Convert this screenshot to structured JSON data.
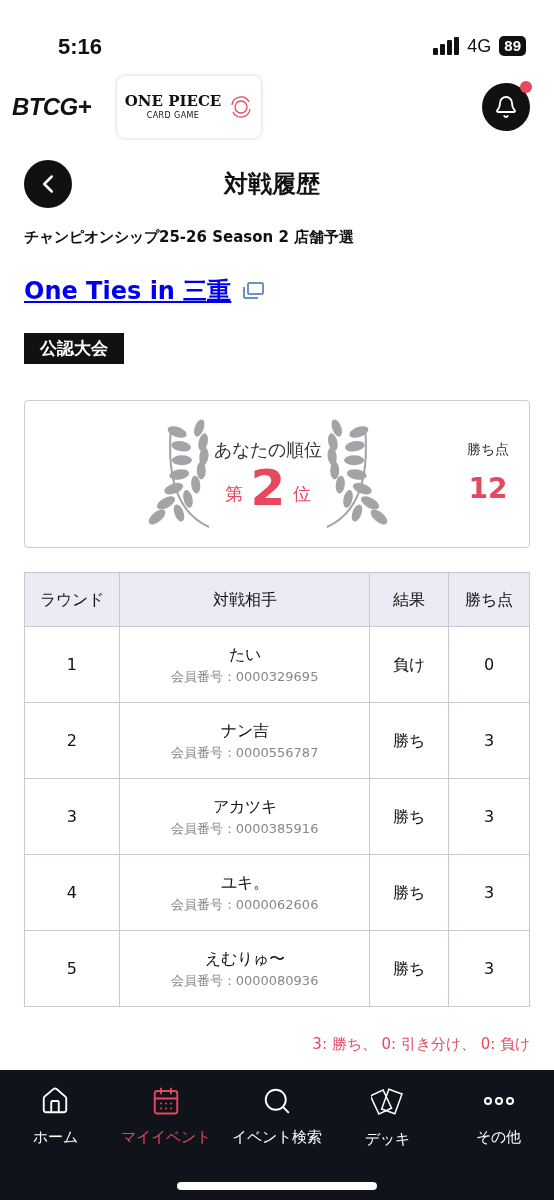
{
  "status_bar": {
    "time": "5:16",
    "network": "4G",
    "battery": "89"
  },
  "header": {
    "logo_text": "BTCG+",
    "game_logo": {
      "title": "ONE PIECE",
      "subtitle": "CARD GAME"
    },
    "notification_unread": true
  },
  "page": {
    "title": "対戦履歴",
    "event_series": "チャンピオンシップ25-26 Season 2 店舗予選",
    "event_name": "One Ties in 三重",
    "badge": "公認大会"
  },
  "rank_card": {
    "label": "あなたの順位",
    "prefix": "第",
    "rank": "2",
    "suffix": "位",
    "points_label": "勝ち点",
    "points": "12"
  },
  "table": {
    "columns": [
      "ラウンド",
      "対戦相手",
      "結果",
      "勝ち点"
    ],
    "rows": [
      {
        "round": "1",
        "opponent": "たい",
        "member_no": "会員番号：0000329695",
        "result": "負け",
        "points": "0"
      },
      {
        "round": "2",
        "opponent": "ナン吉",
        "member_no": "会員番号：0000556787",
        "result": "勝ち",
        "points": "3"
      },
      {
        "round": "3",
        "opponent": "アカツキ",
        "member_no": "会員番号：0000385916",
        "result": "勝ち",
        "points": "3"
      },
      {
        "round": "4",
        "opponent": "ユキ。",
        "member_no": "会員番号：0000062606",
        "result": "勝ち",
        "points": "3"
      },
      {
        "round": "5",
        "opponent": "えむりゅ〜",
        "member_no": "会員番号：0000080936",
        "result": "勝ち",
        "points": "3"
      }
    ]
  },
  "legend": "3: 勝ち、 0: 引き分け、 0: 負け",
  "nav": [
    {
      "kind": "home",
      "label": "ホーム",
      "selected": false
    },
    {
      "kind": "calendar",
      "label": "マイイベント",
      "selected": true
    },
    {
      "kind": "search",
      "label": "イベント検索",
      "selected": false
    },
    {
      "kind": "cards",
      "label": "デッキ",
      "selected": false
    },
    {
      "kind": "more",
      "label": "その他",
      "selected": false
    }
  ]
}
